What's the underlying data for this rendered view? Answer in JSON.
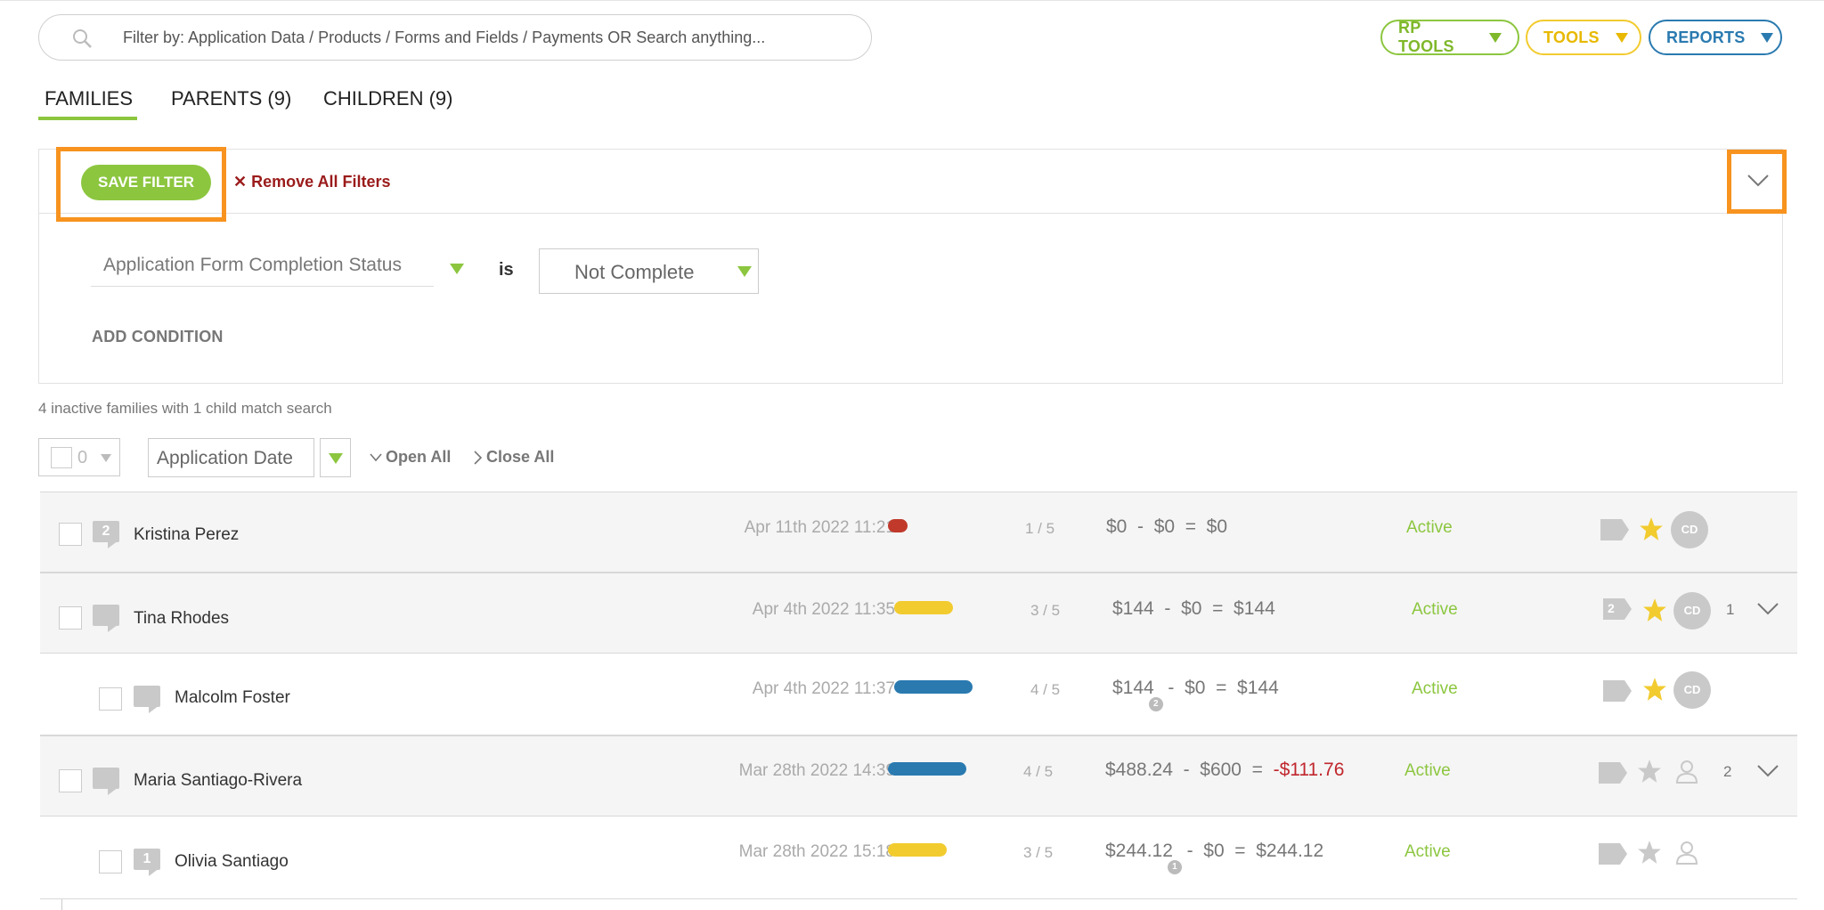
{
  "search": {
    "placeholder": "Filter by: Application Data / Products / Forms and Fields / Payments OR Search anything..."
  },
  "toolbar": {
    "rp_tools": "RP TOOLS",
    "tools": "TOOLS",
    "reports": "REPORTS",
    "colors": {
      "rp_tools": "#8cc63f",
      "tools": "#f2cb2f",
      "reports": "#2a7ab0"
    }
  },
  "tabs": [
    {
      "label": "FAMILIES",
      "active": true
    },
    {
      "label": "PARENTS (9)",
      "active": false
    },
    {
      "label": "CHILDREN (9)",
      "active": false
    }
  ],
  "filter": {
    "save_label": "SAVE FILTER",
    "remove_label": "Remove All Filters",
    "condition": {
      "field": "Application Form Completion Status",
      "operator": "is",
      "value": "Not Complete"
    },
    "add_condition": "ADD CONDITION"
  },
  "summary": "4 inactive families with 1 child match search",
  "list_controls": {
    "selected_count": "0",
    "sort_field": "Application Date",
    "open_all": "Open All",
    "close_all": "Close All"
  },
  "rows": [
    {
      "type": "family",
      "badge": "2",
      "name": "Kristina Perez",
      "date": "Apr 11th 2022 11:21",
      "progress": 0.2,
      "progress_color": "#c0392b",
      "steps": "1 / 5",
      "money": {
        "a": "$0",
        "b": "$0",
        "c": "$0"
      },
      "status": "Active",
      "starred": true,
      "avatar": "CD"
    },
    {
      "type": "family",
      "badge": "",
      "name": "Tina Rhodes",
      "date": "Apr 4th 2022 11:35",
      "progress": 0.6,
      "progress_color": "#f2cb2f",
      "steps": "3 / 5",
      "money": {
        "a": "$144",
        "b": "$0",
        "c": "$144"
      },
      "status": "Active",
      "tag_count": "2",
      "starred": true,
      "avatar": "CD",
      "child_count": "1"
    },
    {
      "type": "child",
      "badge": "",
      "name": "Malcolm Foster",
      "date": "Apr 4th 2022 11:37",
      "progress": 0.8,
      "progress_color": "#2a7ab0",
      "steps": "4 / 5",
      "money": {
        "a": "$144",
        "a_badge": "2",
        "b": "$0",
        "c": "$144"
      },
      "status": "Active",
      "starred": true,
      "avatar": "CD"
    },
    {
      "type": "family",
      "badge": "",
      "name": "Maria Santiago-Rivera",
      "date": "Mar 28th 2022 14:39",
      "progress": 0.8,
      "progress_color": "#2a7ab0",
      "steps": "4 / 5",
      "money": {
        "a": "$488.24",
        "b": "$600",
        "c": "-$111.76"
      },
      "status": "Active",
      "starred": false,
      "child_count": "2"
    },
    {
      "type": "child",
      "badge": "1",
      "name": "Olivia Santiago",
      "date": "Mar 28th 2022 15:18",
      "progress": 0.6,
      "progress_color": "#f2cb2f",
      "steps": "3 / 5",
      "money": {
        "a": "$244.12",
        "a_badge": "1",
        "b": "$0",
        "c": "$244.12"
      },
      "status": "Active",
      "starred": false
    }
  ],
  "symbols": {
    "minus": "-",
    "equals": "="
  }
}
